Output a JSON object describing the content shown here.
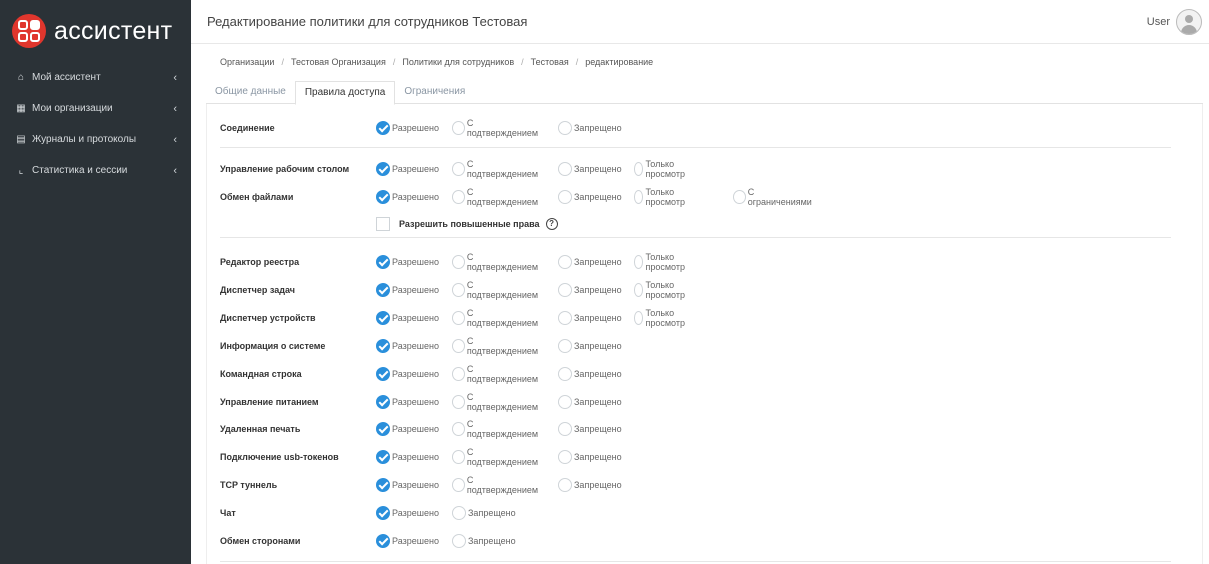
{
  "brand": {
    "logo_text": "ассистент"
  },
  "sidebar": {
    "items": [
      {
        "icon": "home-icon",
        "glyph": "⌂",
        "label": "Мой ассистент"
      },
      {
        "icon": "building-icon",
        "glyph": "▦",
        "label": "Мои организации"
      },
      {
        "icon": "book-icon",
        "glyph": "▤",
        "label": "Журналы и протоколы"
      },
      {
        "icon": "chart-icon",
        "glyph": "⌞",
        "label": "Статистика и сессии"
      }
    ]
  },
  "header": {
    "title": "Редактирование политики для сотрудников Тестовая",
    "user_name": "User"
  },
  "breadcrumb": [
    "Организации",
    "Тестовая Организация",
    "Политики для сотрудников",
    "Тестовая",
    "редактирование"
  ],
  "tabs": [
    {
      "label": "Общие данные",
      "active": false
    },
    {
      "label": "Правила доступа",
      "active": true
    },
    {
      "label": "Ограничения",
      "active": false
    }
  ],
  "options": {
    "allowed": "Разрешено",
    "confirm": "С подтверждением",
    "denied": "Запрещено",
    "view_only": "Только просмотр",
    "limited": "С ограничениями"
  },
  "elevated": {
    "label": "Разрешить повышенные права",
    "checked": false,
    "help": "?"
  },
  "rules": [
    {
      "label": "Соединение",
      "options": [
        "allowed",
        "confirm",
        "denied"
      ],
      "selected": "allowed"
    },
    {
      "label": "Управление рабочим столом",
      "options": [
        "allowed",
        "confirm",
        "denied",
        "view_only"
      ],
      "selected": "allowed"
    },
    {
      "label": "Обмен файлами",
      "options": [
        "allowed",
        "confirm",
        "denied",
        "view_only",
        "limited"
      ],
      "selected": "allowed"
    },
    {
      "label": "Редактор реестра",
      "options": [
        "allowed",
        "confirm",
        "denied",
        "view_only"
      ],
      "selected": "allowed"
    },
    {
      "label": "Диспетчер задач",
      "options": [
        "allowed",
        "confirm",
        "denied",
        "view_only"
      ],
      "selected": "allowed"
    },
    {
      "label": "Диспетчер устройств",
      "options": [
        "allowed",
        "confirm",
        "denied",
        "view_only"
      ],
      "selected": "allowed"
    },
    {
      "label": "Информация о системе",
      "options": [
        "allowed",
        "confirm",
        "denied"
      ],
      "selected": "allowed"
    },
    {
      "label": "Командная строка",
      "options": [
        "allowed",
        "confirm",
        "denied"
      ],
      "selected": "allowed"
    },
    {
      "label": "Управление питанием",
      "options": [
        "allowed",
        "confirm",
        "denied"
      ],
      "selected": "allowed"
    },
    {
      "label": "Удаленная печать",
      "options": [
        "allowed",
        "confirm",
        "denied"
      ],
      "selected": "allowed"
    },
    {
      "label": "Подключение usb-токенов",
      "options": [
        "allowed",
        "confirm",
        "denied"
      ],
      "selected": "allowed"
    },
    {
      "label": "TCP туннель",
      "options": [
        "allowed",
        "confirm",
        "denied"
      ],
      "selected": "allowed"
    },
    {
      "label": "Чат",
      "options": [
        "allowed",
        "denied"
      ],
      "selected": "allowed"
    },
    {
      "label": "Обмен сторонами",
      "options": [
        "allowed",
        "denied"
      ],
      "selected": "allowed"
    }
  ]
}
